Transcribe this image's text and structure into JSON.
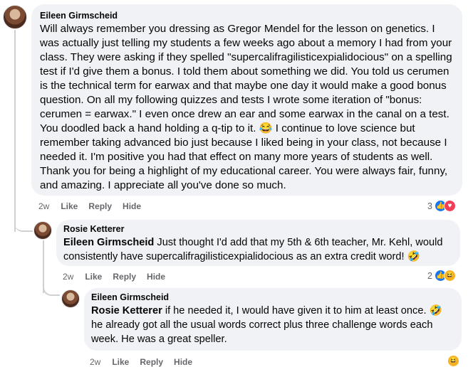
{
  "comments": [
    {
      "author": "Eileen Girmscheid",
      "text": "Will always remember you dressing as Gregor Mendel for the lesson on genetics. I was actually just telling my students a few weeks ago about a memory I had from your class. They were asking if they spelled \"supercalifragilisticexpialidocious\" on a spelling test if I'd give them a bonus. I told them about something we did. You told us cerumen is the technical term for earwax and that maybe one day it would make a good bonus question. On all my following quizzes and tests I wrote some iteration of \"bonus: cerumen = earwax.\" I even once drew an ear and some earwax in the canal on a test. You doodled back a hand holding a q-tip to it. 😂 I continue to love science but remember taking advanced bio just because I liked being in your class, not because I needed it. I'm positive you had that effect on many more years of students as well. Thank you for being a highlight of my educational career. You were always fair, funny, and amazing. I appreciate all you've done so much.",
      "time": "2w",
      "like": "Like",
      "reply": "Reply",
      "hide": "Hide",
      "reaction_count": "3",
      "reactions": [
        "like-icon",
        "love-icon"
      ]
    },
    {
      "author": "Rosie Ketterer",
      "mention": "Eileen Girmscheid",
      "text": " Just thought I'd add that my 5th & 6th teacher, Mr. Kehl, would consistently have supercalifragilisticexpialidocious as an extra credit word! 🤣",
      "time": "2w",
      "like": "Like",
      "reply": "Reply",
      "hide": "Hide",
      "reaction_count": "2",
      "reactions": [
        "like-icon",
        "haha-icon"
      ]
    },
    {
      "author": "Eileen Girmscheid",
      "mention": "Rosie Ketterer",
      "text": " if he needed it, I would have given it to him at least once. 🤣 he already got all the usual words correct plus three challenge words each week. He was a great speller.",
      "time": "2w",
      "like": "Like",
      "reply": "Reply",
      "hide": "Hide",
      "reactions": [
        "haha-icon"
      ]
    }
  ],
  "colors": {
    "bubble": "#f0f2f5",
    "meta": "#65676b",
    "like": "#1877f2",
    "love": "#f33e58",
    "haha": "#f7b125"
  }
}
